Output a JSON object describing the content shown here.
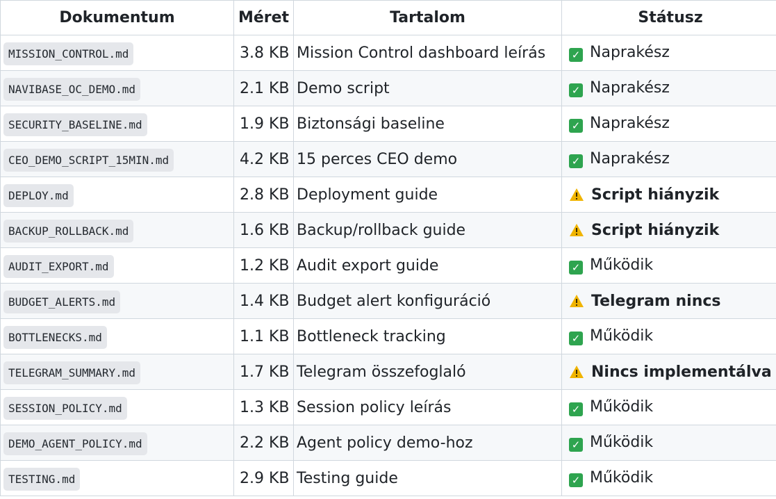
{
  "headers": [
    "Dokumentum",
    "Méret",
    "Tartalom",
    "Státusz"
  ],
  "rows": [
    {
      "doc": "MISSION_CONTROL.md",
      "size": "3.8 KB",
      "content": "Mission Control dashboard leírás",
      "status": "Naprakész",
      "status_type": "ok"
    },
    {
      "doc": "NAVIBASE_OC_DEMO.md",
      "size": "2.1 KB",
      "content": "Demo script",
      "status": "Naprakész",
      "status_type": "ok"
    },
    {
      "doc": "SECURITY_BASELINE.md",
      "size": "1.9 KB",
      "content": "Biztonsági baseline",
      "status": "Naprakész",
      "status_type": "ok"
    },
    {
      "doc": "CEO_DEMO_SCRIPT_15MIN.md",
      "size": "4.2 KB",
      "content": "15 perces CEO demo",
      "status": "Naprakész",
      "status_type": "ok"
    },
    {
      "doc": "DEPLOY.md",
      "size": "2.8 KB",
      "content": "Deployment guide",
      "status": "Script hiányzik",
      "status_type": "warn"
    },
    {
      "doc": "BACKUP_ROLLBACK.md",
      "size": "1.6 KB",
      "content": "Backup/rollback guide",
      "status": "Script hiányzik",
      "status_type": "warn"
    },
    {
      "doc": "AUDIT_EXPORT.md",
      "size": "1.2 KB",
      "content": "Audit export guide",
      "status": "Működik",
      "status_type": "ok"
    },
    {
      "doc": "BUDGET_ALERTS.md",
      "size": "1.4 KB",
      "content": "Budget alert konfiguráció",
      "status": "Telegram nincs",
      "status_type": "warn"
    },
    {
      "doc": "BOTTLENECKS.md",
      "size": "1.1 KB",
      "content": "Bottleneck tracking",
      "status": "Működik",
      "status_type": "ok"
    },
    {
      "doc": "TELEGRAM_SUMMARY.md",
      "size": "1.7 KB",
      "content": "Telegram összefoglaló",
      "status": "Nincs implementálva",
      "status_type": "warn"
    },
    {
      "doc": "SESSION_POLICY.md",
      "size": "1.3 KB",
      "content": "Session policy leírás",
      "status": "Működik",
      "status_type": "ok"
    },
    {
      "doc": "DEMO_AGENT_POLICY.md",
      "size": "2.2 KB",
      "content": "Agent policy demo-hoz",
      "status": "Működik",
      "status_type": "ok"
    },
    {
      "doc": "TESTING.md",
      "size": "2.9 KB",
      "content": "Testing guide",
      "status": "Működik",
      "status_type": "ok"
    }
  ],
  "icons": {
    "ok": "check-icon",
    "warn": "warning-icon"
  },
  "colors": {
    "ok": "#2ea44f",
    "warn": "#f0b400"
  }
}
